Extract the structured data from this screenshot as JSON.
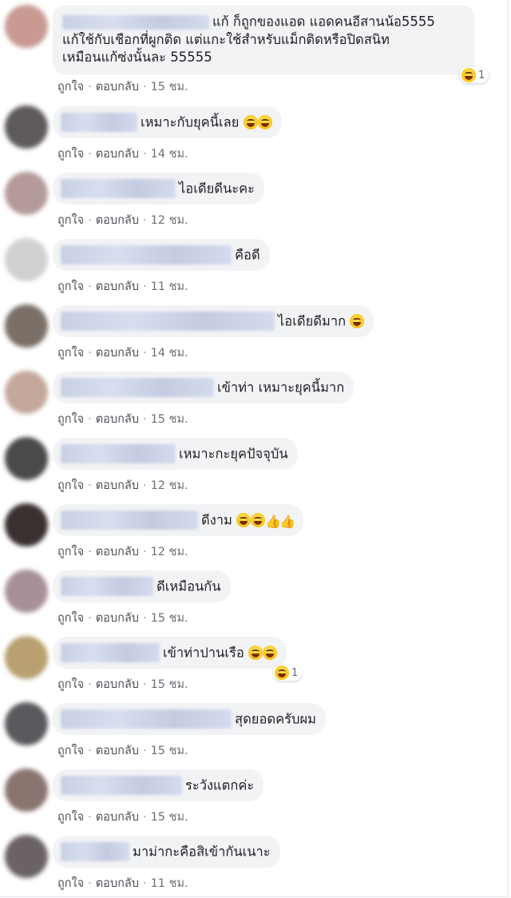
{
  "meta_labels": {
    "like": "ถูกใจ",
    "reply": "ตอบกลับ",
    "separator": "·"
  },
  "comments": [
    {
      "text_line1": "แก้ ก็ถูกของแอด แอดคนอีสานน้อ5555",
      "text_line2": "แก้ใช้กับเชือกที่ผูกติด แต่แกะใช้สำหรับแม็กติดหรือปิดสนิท",
      "text_line3": "เหมือนแก้ซ่งนั้นละ 55555",
      "time": "15 ชม.",
      "reaction": {
        "icon": "laughing-emoji",
        "count": "1"
      },
      "avatar_color": "#c89a92"
    },
    {
      "text": "เหมาะกับยุคนี้เลย",
      "emoji": [
        "laughing-emoji",
        "laughing-emoji"
      ],
      "time": "14 ชม.",
      "avatar_color": "#5e5a5a"
    },
    {
      "text": "ไอเดียดีนะคะ",
      "time": "12 ชม.",
      "avatar_color": "#b59a9a"
    },
    {
      "text": "คือดี",
      "time": "11 ชม.",
      "avatar_color": "#d0d0d0"
    },
    {
      "text": "ไอเดียดีมาก",
      "emoji": [
        "laughing-emoji"
      ],
      "time": "14 ชม.",
      "avatar_color": "#7a7068"
    },
    {
      "text": "เข้าท่า เหมาะยุคนี้มาก",
      "time": "15 ชม.",
      "avatar_color": "#c4a89a"
    },
    {
      "text": "เหมาะกะยุคปัจจุบัน",
      "time": "12 ชม.",
      "avatar_color": "#4a4a4a"
    },
    {
      "text": "ดีงาม",
      "emoji": [
        "grin-emoji",
        "grin-emoji",
        "thumbs-up",
        "thumbs-up"
      ],
      "time": "12 ชม.",
      "avatar_color": "#3a3030"
    },
    {
      "text": "ดีเหมือนกัน",
      "time": "15 ชม.",
      "avatar_color": "#a89098"
    },
    {
      "text": "เข้าท่าปานเรือ",
      "emoji": [
        "laughing-emoji",
        "laughing-emoji"
      ],
      "time": "15 ชม.",
      "reaction": {
        "icon": "laughing-emoji",
        "count": "1"
      },
      "avatar_color": "#b8a070"
    },
    {
      "text": "สุดยอดครับผม",
      "time": "15 ชม.",
      "avatar_color": "#5a5a5e"
    },
    {
      "text": "ระวังแตกค่ะ",
      "time": "15 ชม.",
      "avatar_color": "#8a7470"
    },
    {
      "text": "มาม่ากะคือสิเข้ากันเนาะ",
      "time": "11 ชม.",
      "avatar_color": "#6a6266"
    }
  ]
}
